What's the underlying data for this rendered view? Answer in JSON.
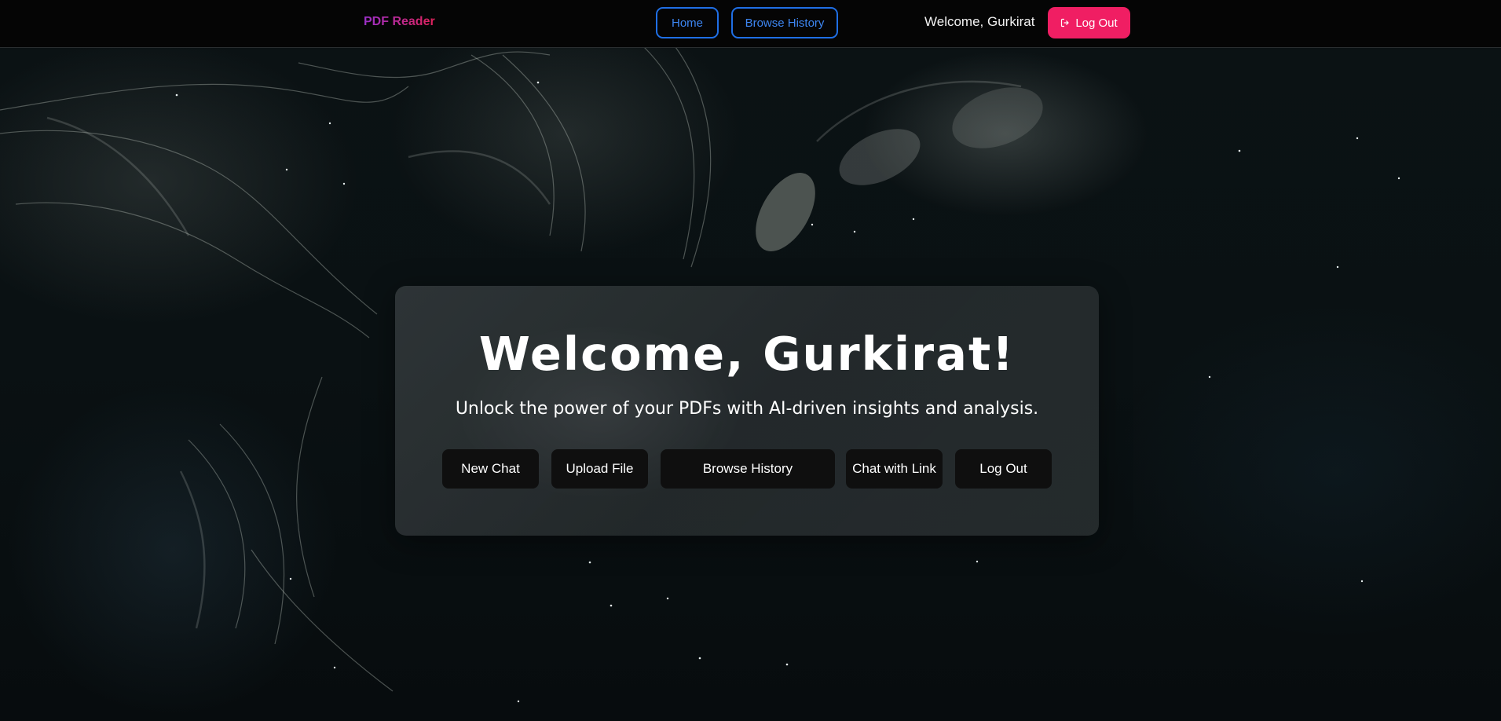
{
  "navbar": {
    "brand": "PDF Reader",
    "links": {
      "home": "Home",
      "browse_history": "Browse History"
    },
    "welcome": "Welcome, Gurkirat",
    "logout_label": "Log Out",
    "logout_icon": "logout-icon"
  },
  "hero": {
    "title": "Welcome, Gurkirat!",
    "subtitle": "Unlock the power of your PDFs with AI-driven insights and analysis.",
    "buttons": {
      "new_chat": "New Chat",
      "upload_file": "Upload File",
      "browse_history": "Browse History",
      "chat_with_link": "Chat with Link",
      "log_out": "Log Out"
    }
  },
  "colors": {
    "brand_gradient_start": "#9b30c9",
    "brand_gradient_end": "#e0225a",
    "nav_outline_blue": "#1f6fe5",
    "logout_pink": "#f01e63",
    "action_button_bg": "#0f0f0f"
  }
}
